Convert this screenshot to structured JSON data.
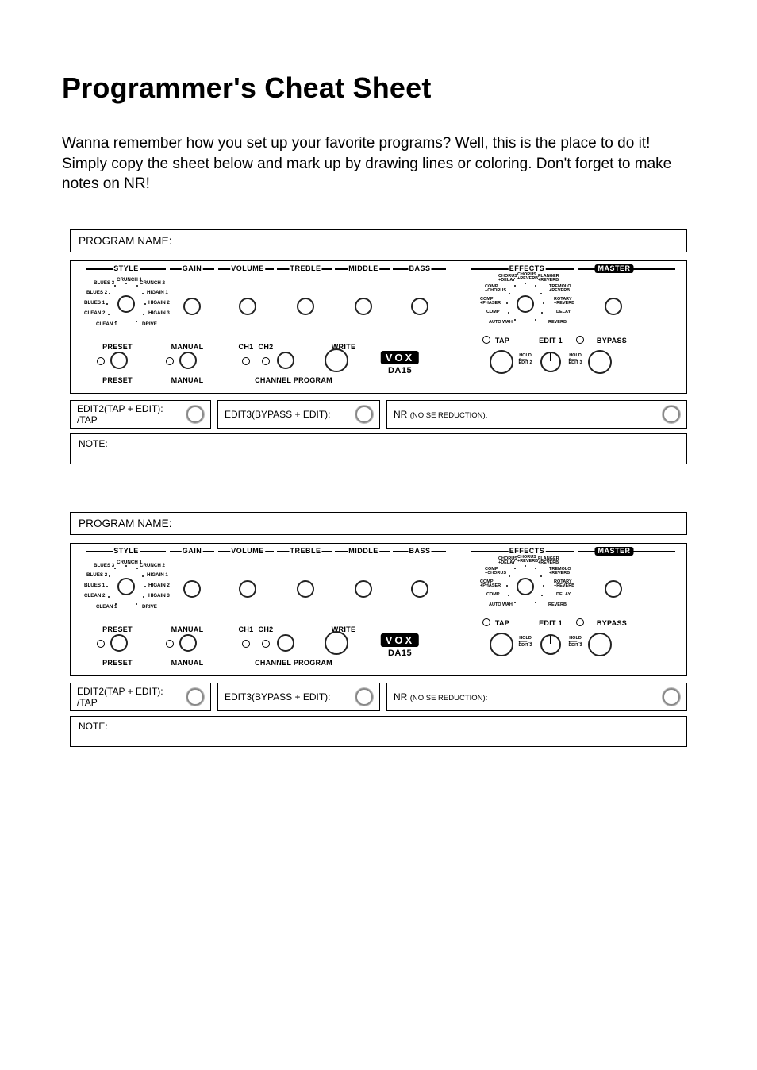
{
  "title": "Programmer's Cheat Sheet",
  "intro": "Wanna remember how you set up your favorite programs? Well, this is the place to do it! Simply copy the sheet below and mark up by drawing lines or coloring. Don't forget to make notes on NR!",
  "program_name_label": "PROGRAM NAME:",
  "panel": {
    "sections": {
      "style": "STYLE",
      "gain": "GAIN",
      "volume": "VOLUME",
      "treble": "TREBLE",
      "middle": "MIDDLE",
      "bass": "BASS",
      "effects": "EFFECTS",
      "master": "MASTER"
    },
    "style_labels": {
      "crunch1": "CRUNCH 1",
      "crunch2": "CRUNCH 2",
      "blues3": "BLUES 3",
      "blues2": "BLUES 2",
      "blues1": "BLUES 1",
      "clean2": "CLEAN 2",
      "clean1": "CLEAN 1",
      "higain1": "HIGAIN 1",
      "higain2": "HIGAIN 2",
      "higain3": "HIGAIN 3",
      "drive": "DRIVE"
    },
    "effects_labels": {
      "chorus_delay": "CHORUS\n+DELAY",
      "chorus_reverb": "CHORUS\n+REVERB",
      "flanger_reverb": "FLANGER\n+REVERB",
      "comp_chorus": "COMP\n+CHORUS",
      "tremolo_reverb": "TREMOLO\n+REVERB",
      "comp_phaser": "COMP\n+PHASER",
      "rotary_reverb": "ROTARY\n+REVERB",
      "comp": "COMP",
      "delay": "DELAY",
      "autowah": "AUTO WAH",
      "reverb": "REVERB"
    },
    "bottom": {
      "preset_top": "PRESET",
      "preset_bottom": "PRESET",
      "manual_top": "MANUAL",
      "manual_bottom": "MANUAL",
      "ch1": "CH1",
      "ch2": "CH2",
      "write": "WRITE",
      "channel_program": "CHANNEL PROGRAM",
      "tap": "TAP",
      "edit1": "EDIT 1",
      "bypass": "BYPASS",
      "hold": "HOLD",
      "edit2": "EDIT 2",
      "edit3": "EDIT 3"
    },
    "logo": "VOX",
    "model": "DA15"
  },
  "editrow": {
    "edit2": "EDIT2(TAP + EDIT): /TAP",
    "edit2_a": "EDIT2(TAP + EDIT):",
    "edit2_b": "/TAP",
    "edit3": "EDIT3(BYPASS + EDIT):",
    "nr": "NR",
    "nr_sub": "(NOISE REDUCTION):"
  },
  "note_label": "NOTE:"
}
